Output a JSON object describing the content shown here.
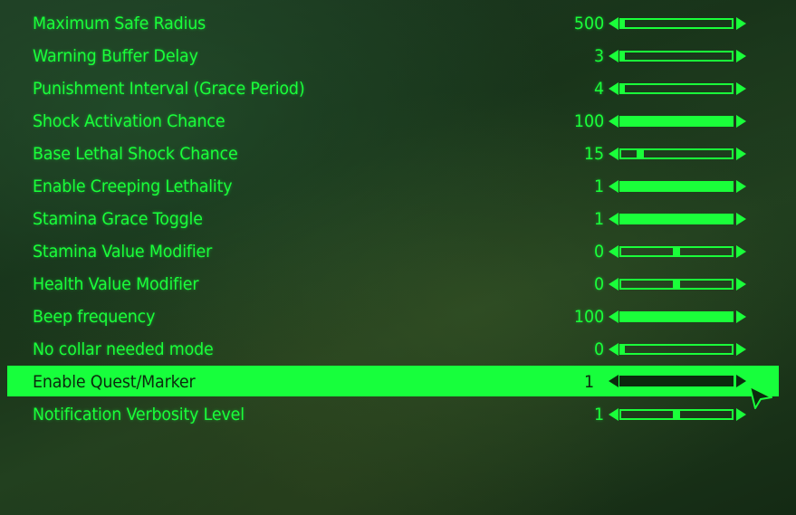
{
  "settings": {
    "items": [
      {
        "label": "Maximum Safe Radius",
        "value": "500",
        "level": 0.0,
        "mode": "fill"
      },
      {
        "label": "Warning Buffer Delay",
        "value": "3",
        "level": 0.0,
        "mode": "fill"
      },
      {
        "label": "Punishment Interval (Grace Period)",
        "value": "4",
        "level": 0.0,
        "mode": "fill"
      },
      {
        "label": "Shock Activation Chance",
        "value": "100",
        "level": 1.0,
        "mode": "fill"
      },
      {
        "label": "Base Lethal Shock Chance",
        "value": "15",
        "level": 0.15,
        "mode": "thumb"
      },
      {
        "label": "Enable Creeping Lethality",
        "value": "1",
        "level": 1.0,
        "mode": "fill"
      },
      {
        "label": "Stamina Grace Toggle",
        "value": "1",
        "level": 1.0,
        "mode": "fill"
      },
      {
        "label": "Stamina Value Modifier",
        "value": "0",
        "level": 0.5,
        "mode": "thumb"
      },
      {
        "label": "Health Value Modifier",
        "value": "0",
        "level": 0.5,
        "mode": "thumb"
      },
      {
        "label": "Beep frequency",
        "value": "100",
        "level": 1.0,
        "mode": "fill"
      },
      {
        "label": "No collar needed mode",
        "value": "0",
        "level": 0.0,
        "mode": "fill"
      },
      {
        "label": "Enable Quest/Marker",
        "value": "1",
        "level": 1.0,
        "mode": "fill",
        "selected": true
      },
      {
        "label": "Notification Verbosity Level",
        "value": "1",
        "level": 0.5,
        "mode": "thumb"
      }
    ]
  },
  "colors": {
    "accent": "#1aff3a",
    "selected_bg": "#17ff3c",
    "selected_text": "#0b2a0d"
  }
}
